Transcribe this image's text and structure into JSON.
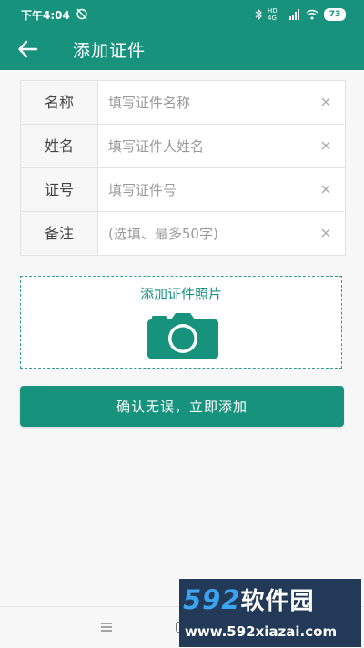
{
  "status_bar": {
    "time": "下午4:04",
    "network": "HD 4G",
    "battery": "73"
  },
  "app_bar": {
    "title": "添加证件",
    "back_icon": "arrow-left-icon"
  },
  "form": {
    "rows": [
      {
        "label": "名称",
        "placeholder": "填写证件名称",
        "value": ""
      },
      {
        "label": "姓名",
        "placeholder": "填写证件人姓名",
        "value": ""
      },
      {
        "label": "证号",
        "placeholder": "填写证件号",
        "value": ""
      },
      {
        "label": "备注",
        "placeholder": "(选填、最多50字)",
        "value": ""
      }
    ],
    "clear_icon": "close-icon"
  },
  "photo": {
    "label": "添加证件照片",
    "icon": "camera-icon"
  },
  "confirm_button": {
    "label": "确认无误，立即添加"
  },
  "watermark": {
    "brand_number": "592",
    "brand_text": "软件园",
    "url": "www.592xiazai.com"
  },
  "colors": {
    "primary": "#17927d",
    "background": "#f7f7f7",
    "watermark_bg": "#223a57",
    "watermark_accent": "#3ba3ef"
  }
}
